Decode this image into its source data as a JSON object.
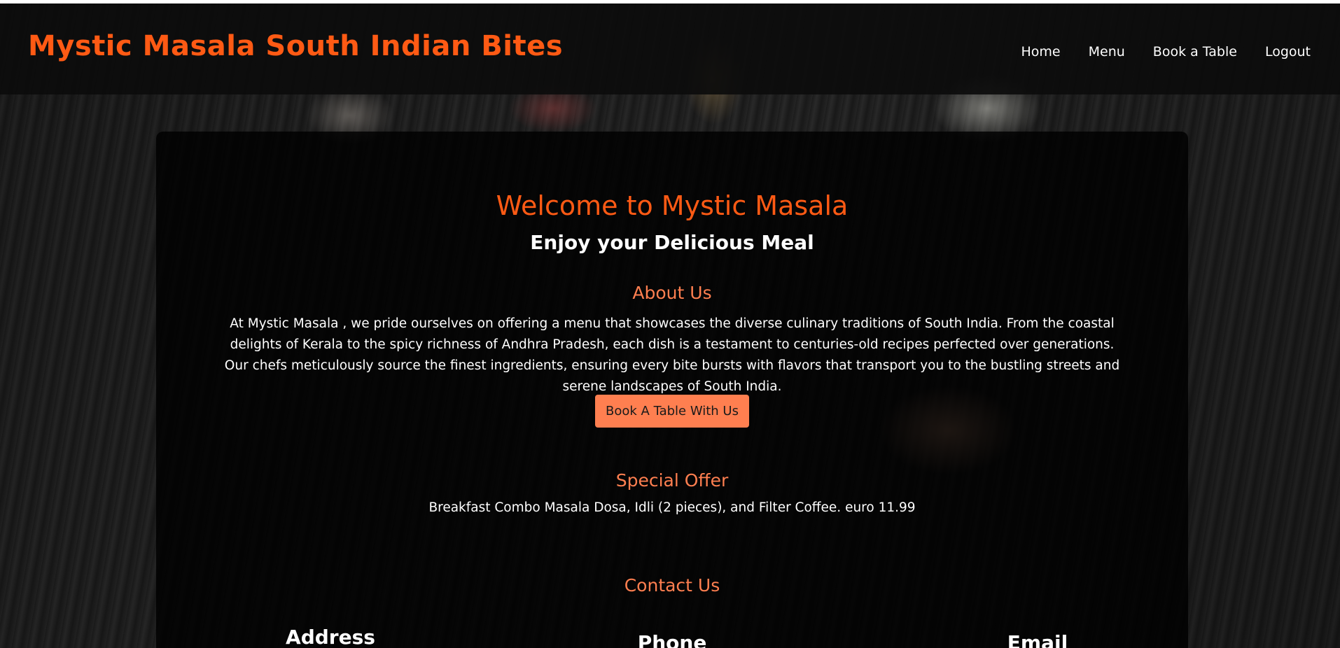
{
  "header": {
    "brand": "Mystic Masala South Indian Bites",
    "nav": [
      "Home",
      "Menu",
      "Book a Table",
      "Logout"
    ]
  },
  "hero": {
    "welcome": "Welcome to Mystic Masala",
    "tagline": "Enjoy your Delicious Meal"
  },
  "about": {
    "title": "About Us",
    "text": "At Mystic Masala , we pride ourselves on offering a menu that showcases the diverse culinary traditions of South India. From the coastal delights of Kerala to the spicy richness of Andhra Pradesh, each dish is a testament to centuries-old recipes perfected over generations. Our chefs meticulously source the finest ingredients, ensuring every bite bursts with flavors that transport you to the bustling streets and serene landscapes of South India.",
    "button": "Book A Table With Us"
  },
  "offer": {
    "title": "Special Offer",
    "text": "Breakfast Combo Masala Dosa, Idli (2 pieces), and Filter Coffee. euro 11.99"
  },
  "contact": {
    "title": "Contact Us",
    "address_label": "Address",
    "phone_label": "Phone",
    "email_label": "Email"
  },
  "colors": {
    "brand": "#ff5a14",
    "accent": "#ff7f50",
    "header_bg": "#0c0c0c"
  }
}
